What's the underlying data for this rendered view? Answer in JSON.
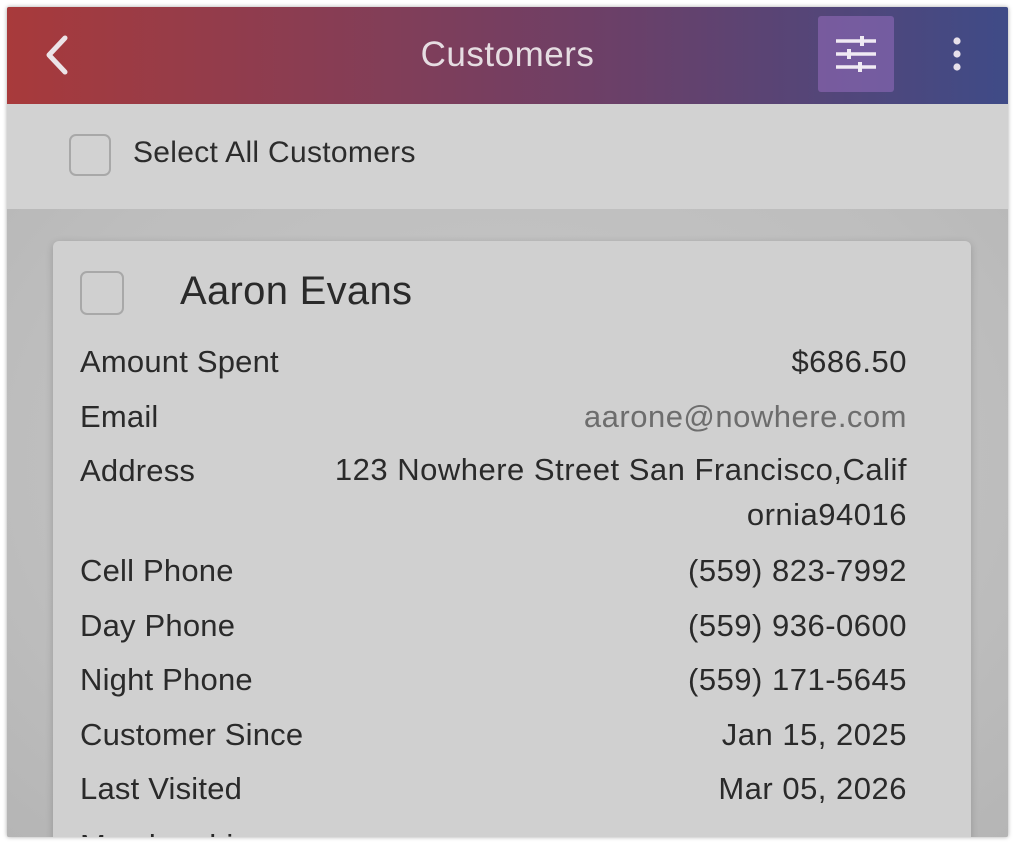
{
  "header": {
    "title": "Customers",
    "back_icon": "chevron-left-icon",
    "filter_icon": "sliders-icon",
    "more_icon": "more-vertical-icon",
    "gradient_colors": [
      "#a83a3b",
      "#6e3f66",
      "#3f4b87"
    ]
  },
  "select_all": {
    "label": "Select All Customers",
    "checked": false
  },
  "customer": {
    "name": "Aaron Evans",
    "checked": false,
    "fields": {
      "amount_spent": {
        "label": "Amount Spent",
        "value": "$686.50"
      },
      "email": {
        "label": "Email",
        "value": "aarone@nowhere.com"
      },
      "address": {
        "label": "Address",
        "line1": "123 Nowhere Street San Francisco,Calif",
        "line2": "ornia94016"
      },
      "cell_phone": {
        "label": "Cell Phone",
        "value": "(559) 823-7992"
      },
      "day_phone": {
        "label": "Day Phone",
        "value": "(559) 936-0600"
      },
      "night_phone": {
        "label": "Night Phone",
        "value": "(559) 171-5645"
      },
      "customer_since": {
        "label": "Customer Since",
        "value": "Jan 15, 2025"
      },
      "last_visited": {
        "label": "Last Visited",
        "value": "Mar 05, 2026"
      },
      "membership_partial": {
        "label": "Membership"
      }
    }
  }
}
